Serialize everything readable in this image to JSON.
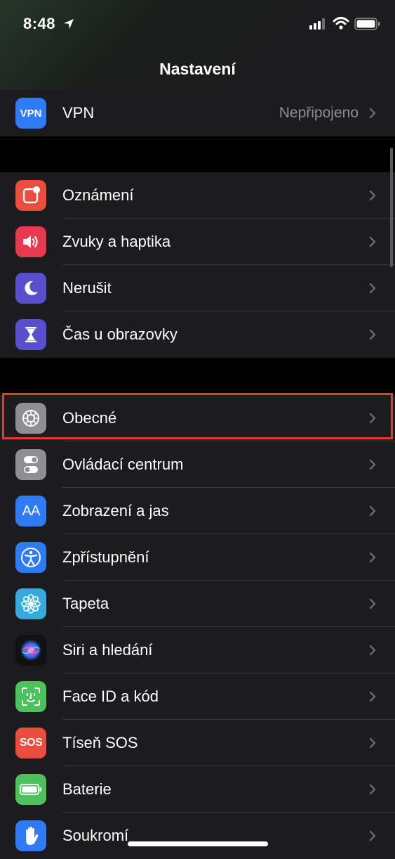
{
  "status_bar": {
    "time": "8:48"
  },
  "nav": {
    "title": "Nastavení"
  },
  "groups": [
    {
      "rows": [
        {
          "label": "VPN",
          "value": "Nepřipojeno",
          "icon_text": "VPN",
          "color": "#2f7bf6"
        }
      ]
    },
    {
      "rows": [
        {
          "label": "Oznámení",
          "color": "#ea4d3d"
        },
        {
          "label": "Zvuky a haptika",
          "color": "#e8384f"
        },
        {
          "label": "Nerušit",
          "color": "#5a4fcf"
        },
        {
          "label": "Čas u obrazovky",
          "color": "#5a4fcf"
        }
      ]
    },
    {
      "rows": [
        {
          "label": "Obecné",
          "color": "#8e8e93"
        },
        {
          "label": "Ovládací centrum",
          "color": "#8e8e93"
        },
        {
          "label": "Zobrazení a jas",
          "icon_text": "AA",
          "color": "#2f7bf6"
        },
        {
          "label": "Zpřístupnění",
          "color": "#2f7bf6"
        },
        {
          "label": "Tapeta",
          "color": "#35aadc"
        },
        {
          "label": "Siri a hledání",
          "color": "#1a1a2e"
        },
        {
          "label": "Face ID a kód",
          "color": "#4cc15c"
        },
        {
          "label": "Tíseň SOS",
          "icon_text": "SOS",
          "color": "#ea4d3d"
        },
        {
          "label": "Baterie",
          "color": "#4cc15c"
        },
        {
          "label": "Soukromí",
          "color": "#2f7bf6"
        }
      ]
    }
  ]
}
